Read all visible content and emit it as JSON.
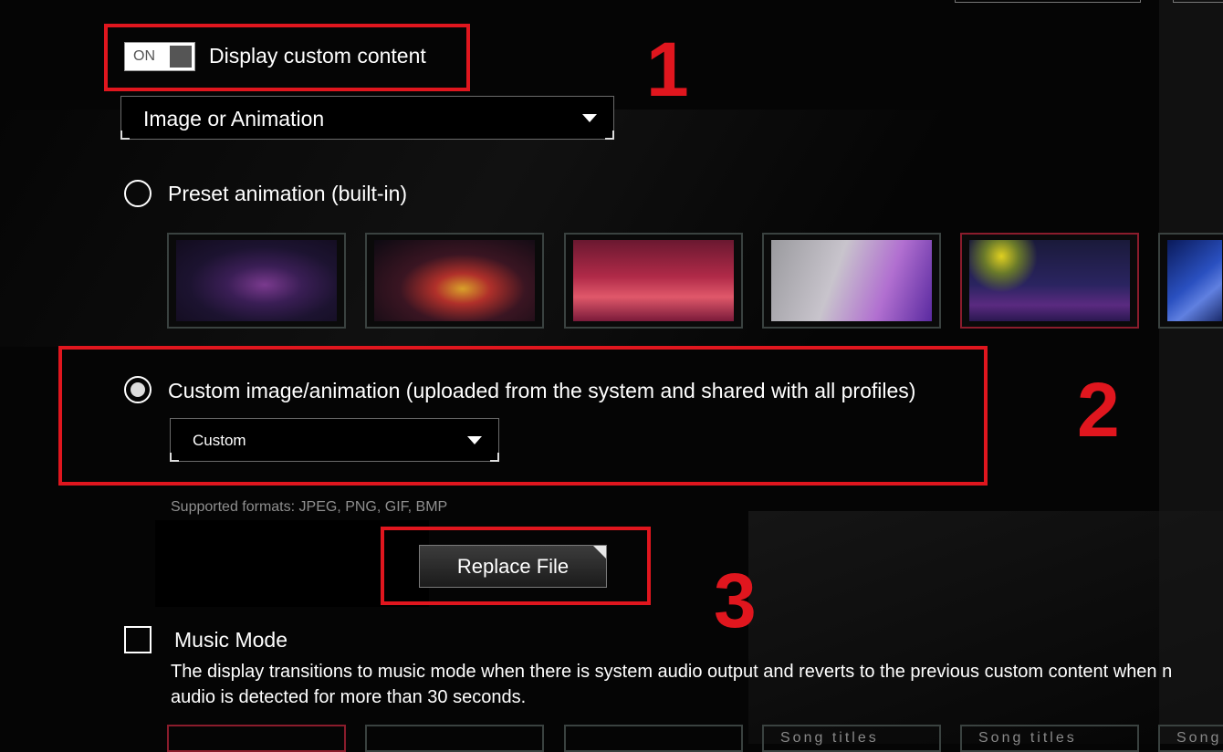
{
  "display_toggle": {
    "state": "ON",
    "label": "Display custom content"
  },
  "content_type_select": {
    "value": "Image or Animation"
  },
  "preset_option": {
    "label": "Preset animation (built-in)",
    "selected": false
  },
  "preset_thumbnails": [
    {
      "name": "rog-eye-purple",
      "selected": false
    },
    {
      "name": "rog-particles-orange",
      "selected": false
    },
    {
      "name": "rog-city-red",
      "selected": false
    },
    {
      "name": "purple-wave",
      "selected": false
    },
    {
      "name": "fireworks-city",
      "selected": true
    },
    {
      "name": "blue-logo",
      "selected": false
    }
  ],
  "custom_option": {
    "label": "Custom image/animation (uploaded from the system and shared with all profiles)",
    "selected": true
  },
  "custom_select": {
    "value": "Custom"
  },
  "supported_formats": "Supported formats: JPEG, PNG, GIF, BMP",
  "replace_button": {
    "label": "Replace File"
  },
  "music_mode": {
    "label": "Music Mode",
    "checked": false,
    "description": "The display transitions to music mode when there is system audio output and reverts to the previous custom content when n\naudio is detected for more than 30 seconds."
  },
  "music_thumbnails": [
    {
      "text": ""
    },
    {
      "text": ""
    },
    {
      "text": ""
    },
    {
      "text": "Song titles"
    },
    {
      "text": "Song titles"
    },
    {
      "text": "Song"
    }
  ],
  "annotations": [
    "1",
    "2",
    "3"
  ],
  "colors": {
    "annotation_red": "#e0161e",
    "selected_border": "#8a1c2c",
    "background": "#050505"
  }
}
